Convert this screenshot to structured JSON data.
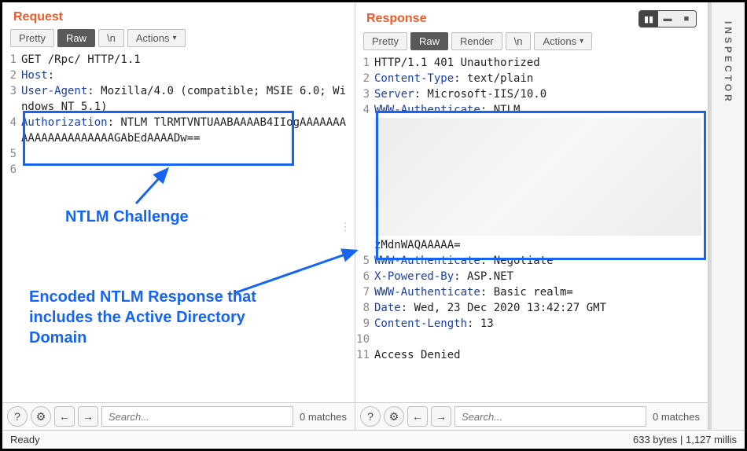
{
  "request": {
    "title": "Request",
    "tabs": {
      "pretty": "Pretty",
      "raw": "Raw",
      "newline": "\\n",
      "actions": "Actions"
    },
    "lines": [
      {
        "n": 1,
        "text": "GET /Rpc/ HTTP/1.1"
      },
      {
        "n": 2,
        "key": "Host",
        "val": ": "
      },
      {
        "n": 3,
        "key": "User-Agent",
        "val": ": Mozilla/4.0 (compatible; MSIE 6.0; Windows NT 5.1)"
      },
      {
        "n": 4,
        "key": "Authorization",
        "val": ": NTLM TlRMTVNTUAABAAAAB4IIogAAAAAAAAAAAAAAAAAAAAAGAbEdAAAADw=="
      },
      {
        "n": 5,
        "text": ""
      },
      {
        "n": 6,
        "text": ""
      }
    ],
    "search_placeholder": "Search...",
    "matches": "0 matches"
  },
  "response": {
    "title": "Response",
    "tabs": {
      "pretty": "Pretty",
      "raw": "Raw",
      "render": "Render",
      "newline": "\\n",
      "actions": "Actions"
    },
    "lines_a": [
      {
        "n": 1,
        "text": "HTTP/1.1 401 Unauthorized"
      },
      {
        "n": 2,
        "key": "Content-Type",
        "val": ": text/plain"
      },
      {
        "n": 3,
        "key": "Server",
        "val": ": Microsoft-IIS/10.0"
      },
      {
        "n": 4,
        "key": "WWW-Authenticate",
        "val": ": NTLM "
      }
    ],
    "blurred_tail": "zMdnWAQAAAAA=",
    "lines_b": [
      {
        "n": 5,
        "key": "WWW-Authenticate",
        "val": ": Negotiate"
      },
      {
        "n": 6,
        "key": "X-Powered-By",
        "val": ": ASP.NET"
      },
      {
        "n": 7,
        "key": "WWW-Authenticate",
        "val": ": Basic realm="
      },
      {
        "n": 8,
        "key": "Date",
        "val": ": Wed, 23 Dec 2020 13:42:27 GMT"
      },
      {
        "n": 9,
        "key": "Content-Length",
        "val": ": 13"
      },
      {
        "n": 10,
        "text": ""
      },
      {
        "n": 11,
        "text": "Access Denied"
      }
    ],
    "search_placeholder": "Search...",
    "matches": "0 matches"
  },
  "annotations": {
    "challenge": "NTLM Challenge",
    "encoded": "Encoded NTLM Response that includes the Active Directory Domain"
  },
  "inspector": "INSPECTOR",
  "status": {
    "left": "Ready",
    "right": "633 bytes | 1,127 millis"
  }
}
